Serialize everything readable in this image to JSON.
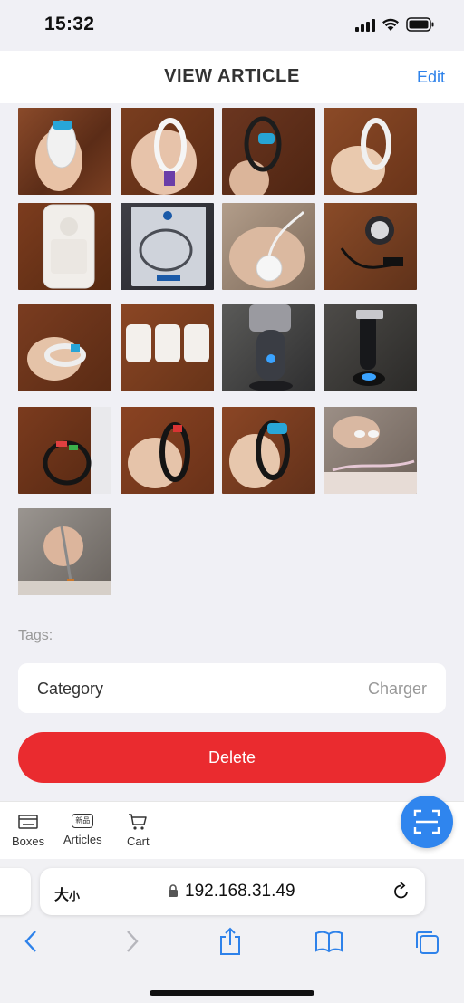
{
  "status": {
    "time": "15:32",
    "icons": [
      "cellular-signal-icon",
      "wifi-icon",
      "battery-icon"
    ]
  },
  "header": {
    "title": "VIEW ARTICLE",
    "edit_label": "Edit"
  },
  "photos": {
    "count": 17,
    "columns": 4
  },
  "tags": {
    "label": "Tags:"
  },
  "category": {
    "label": "Category",
    "value": "Charger"
  },
  "actions": {
    "delete_label": "Delete"
  },
  "tab_bar": {
    "tabs": [
      {
        "label": "Boxes",
        "icon": "box-icon"
      },
      {
        "label": "Articles",
        "icon": "new-article-icon",
        "icon_text": "新品"
      },
      {
        "label": "Cart",
        "icon": "cart-icon"
      }
    ],
    "scan_icon": "scan-icon"
  },
  "browser": {
    "text_size_label": "大",
    "text_size_small": "小",
    "url": "192.168.31.49",
    "toolbar_icons": [
      "back-icon",
      "forward-icon",
      "share-icon",
      "bookmarks-icon",
      "tabs-icon"
    ]
  },
  "colors": {
    "accent": "#2e82ea",
    "danger": "#ea2b2f",
    "fab": "#2f85ee"
  }
}
